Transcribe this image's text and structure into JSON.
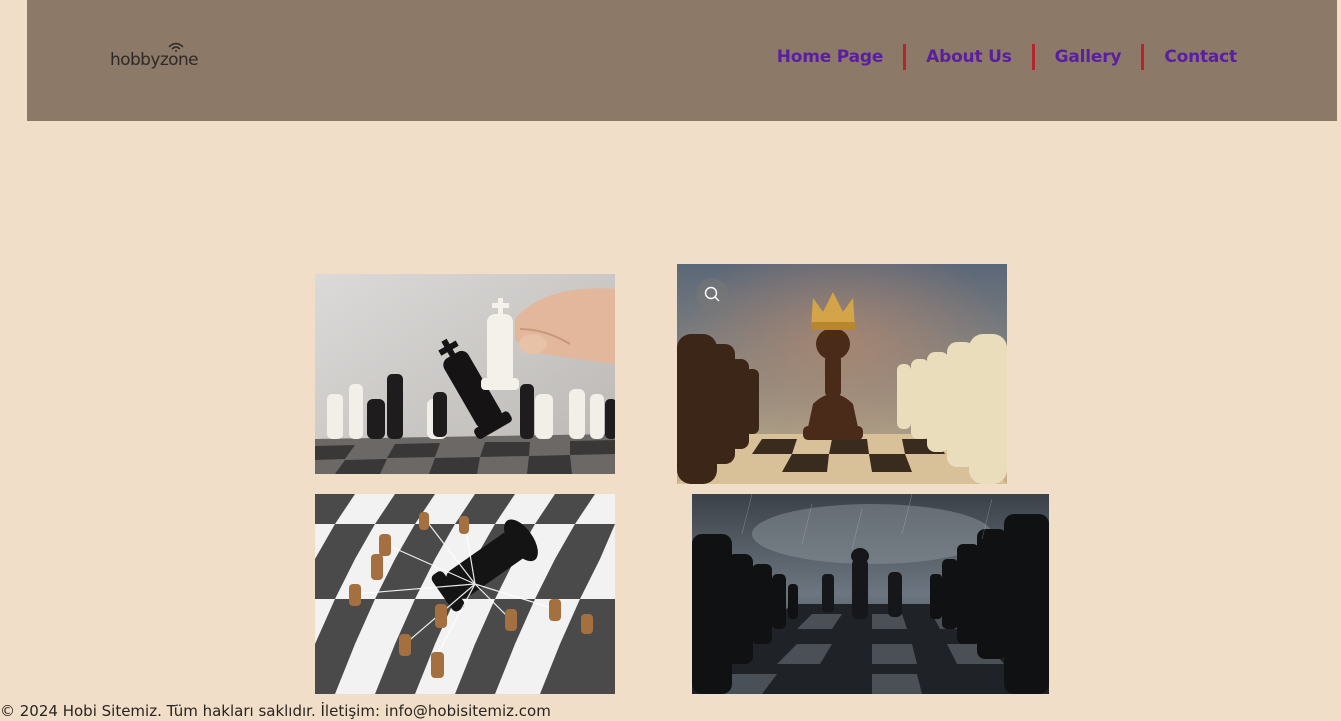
{
  "header": {
    "logo_text": "hobbyzone",
    "nav": [
      {
        "label": "Home Page"
      },
      {
        "label": "About Us"
      },
      {
        "label": "Gallery"
      },
      {
        "label": "Contact"
      }
    ]
  },
  "gallery": {
    "images": [
      {
        "subject": "hand moving white king capturing black king on chessboard"
      },
      {
        "subject": "pawn wearing a golden crown between rows of pieces"
      },
      {
        "subject": "fallen black king tied with strings to brown pawns"
      },
      {
        "subject": "dark stormy chessboard with black pieces"
      }
    ],
    "zoom_icon": "search-icon"
  },
  "footer": {
    "text": "© 2024 Hobi Sitemiz. Tüm hakları saklıdır. İletişim: info@hobisitemiz.com"
  },
  "colors": {
    "background": "#f1dec9",
    "header": "#8c7967",
    "nav_link": "#5a1fa0",
    "nav_separator": "#b5252f"
  }
}
